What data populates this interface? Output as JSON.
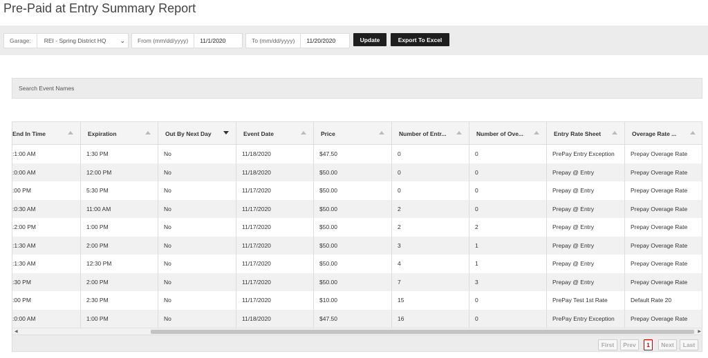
{
  "page": {
    "title": "Pre-Paid at Entry Summary Report"
  },
  "filters": {
    "garage_label": "Garage:",
    "garage_value": "REI - Spring District HQ",
    "from_label": "From (mm/dd/yyyy)",
    "from_value": "11/1/2020",
    "to_label": "To (mm/dd/yyyy)",
    "to_value": "11/20/2020",
    "update_label": "Update",
    "export_label": "Export To Excel"
  },
  "search": {
    "placeholder": "Search Event Names"
  },
  "table": {
    "columns": [
      "End In Time",
      "Expiration",
      "Out By Next Day",
      "Event Date",
      "Price",
      "Number of Entr...",
      "Number of Ove...",
      "Entry Rate Sheet",
      "Overage Rate ..."
    ],
    "sorted_column": "Out By Next Day",
    "rows": [
      [
        ":1:00 AM",
        "1:30 PM",
        "No",
        "11/18/2020",
        "$47.50",
        "0",
        "0",
        "PrePay Entry Exception",
        "Prepay Overage Rate"
      ],
      [
        ":0:00 AM",
        "12:00 PM",
        "No",
        "11/18/2020",
        "$50.00",
        "0",
        "0",
        "Prepay @ Entry",
        "Prepay Overage Rate"
      ],
      [
        ":00 PM",
        "5:30 PM",
        "No",
        "11/17/2020",
        "$50.00",
        "0",
        "0",
        "Prepay @ Entry",
        "Prepay Overage Rate"
      ],
      [
        ":0:30 AM",
        "11:00 AM",
        "No",
        "11/17/2020",
        "$50.00",
        "2",
        "0",
        "Prepay @ Entry",
        "Prepay Overage Rate"
      ],
      [
        ":2:00 PM",
        "1:00 PM",
        "No",
        "11/17/2020",
        "$50.00",
        "2",
        "2",
        "Prepay @ Entry",
        "Prepay Overage Rate"
      ],
      [
        ":1:30 AM",
        "2:00 PM",
        "No",
        "11/17/2020",
        "$50.00",
        "3",
        "1",
        "Prepay @ Entry",
        "Prepay Overage Rate"
      ],
      [
        ":1:30 AM",
        "12:30 PM",
        "No",
        "11/17/2020",
        "$50.00",
        "4",
        "1",
        "Prepay @ Entry",
        "Prepay Overage Rate"
      ],
      [
        ":30 PM",
        "2:00 PM",
        "No",
        "11/17/2020",
        "$50.00",
        "7",
        "3",
        "Prepay @ Entry",
        "Prepay Overage Rate"
      ],
      [
        ":00 PM",
        "2:30 PM",
        "No",
        "11/17/2020",
        "$10.00",
        "15",
        "0",
        "PrePay Test 1st Rate",
        "Default Rate 20"
      ],
      [
        ":0:00 AM",
        "1:00 PM",
        "No",
        "11/18/2020",
        "$47.50",
        "16",
        "0",
        "PrePay Entry Exception",
        "Prepay Overage Rate"
      ]
    ]
  },
  "pager": {
    "first": "First",
    "prev": "Prev",
    "current": "1",
    "next": "Next",
    "last": "Last"
  }
}
